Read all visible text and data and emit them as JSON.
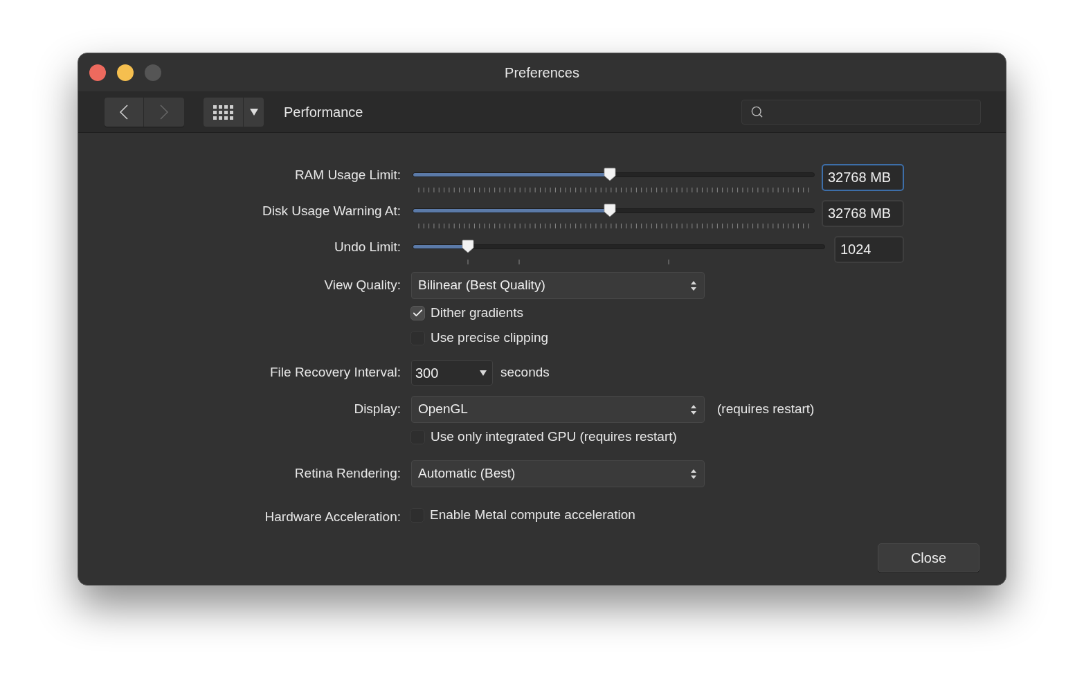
{
  "window": {
    "title": "Preferences"
  },
  "toolbar": {
    "section": "Performance"
  },
  "rows": [
    {
      "kind": "fine_slider",
      "label": "RAM Usage Limit:",
      "level": 0.49,
      "value": "32768 MB",
      "focused": true
    },
    {
      "kind": "fine_slider",
      "label": "Disk Usage Warning At:",
      "level": 0.49,
      "value": "32768 MB",
      "focused": false
    },
    {
      "kind": "coarse_slider",
      "label": "Undo Limit:",
      "level": 0.135,
      "value": "1024",
      "focused": false
    },
    {
      "kind": "select",
      "label": "View Quality:",
      "value": "Bilinear (Best Quality)",
      "checkboxes": [
        {
          "label": "Dither gradients",
          "checked": true
        },
        {
          "label": "Use precise clipping",
          "checked": false
        }
      ]
    },
    {
      "kind": "combo",
      "label": "File Recovery Interval:",
      "value": "300",
      "suffix": "seconds"
    },
    {
      "kind": "select",
      "label": "Display:",
      "value": "OpenGL",
      "note": "(requires restart)",
      "checkboxes": [
        {
          "label": "Use only integrated GPU (requires restart)",
          "checked": false
        }
      ]
    },
    {
      "kind": "select",
      "label": "Retina Rendering:",
      "value": "Automatic (Best)"
    },
    {
      "kind": "checkbox",
      "label": "Hardware Acceleration:",
      "checkboxes": [
        {
          "label": "Enable Metal compute acceleration",
          "checked": false
        }
      ]
    }
  ],
  "buttons": [
    "Close"
  ]
}
